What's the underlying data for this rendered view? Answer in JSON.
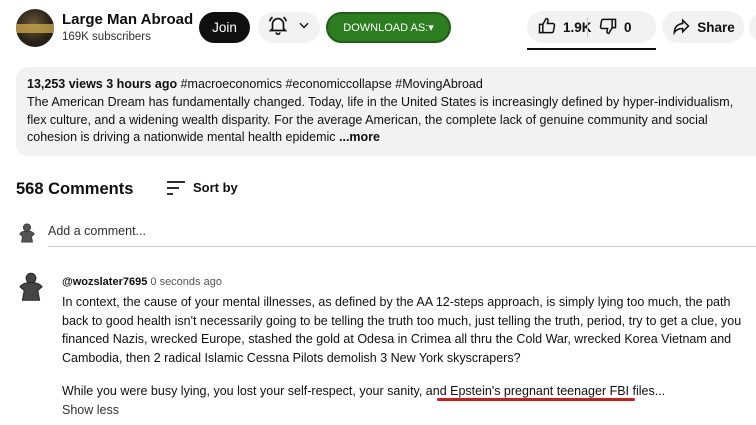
{
  "channel": {
    "name": "Large Man Abroad",
    "subscribers": "169K subscribers",
    "join_label": "Join",
    "download_label": "DOWNLOAD AS:▾"
  },
  "actions": {
    "likes": "1.9K",
    "dislikes": "0",
    "share_label": "Share"
  },
  "description": {
    "views": "13,253 views",
    "time": "3 hours ago",
    "tags": "#macroeconomics #economiccollapse #MovingAbroad",
    "text": "The American Dream has fundamentally changed. Today, life in the United States is increasingly defined by hyper-individualism, flex culture, and a widening wealth disparity. For the average American, the complete lack of genuine community and social cohesion is driving a nationwide mental health epidemic",
    "more_label": "...more"
  },
  "comments": {
    "count": "568 Comments",
    "sort_label": "Sort by",
    "add_placeholder": "Add a comment...",
    "items": [
      {
        "author": "@wozslater7695",
        "time": "0 seconds ago",
        "paragraph1": "In context, the cause of your mental illnesses, as defined by the AA 12-steps approach, is simply lying too much, the path back to good health isn't necessarily going to be telling the truth too much, just telling the truth, period, try to get a clue, you financed Nazis, wrecked Europe, stashed the gold at Odesa in Crimea all thru the Cold War, wrecked Korea Vietnam and Cambodia, then 2 radical Islamic Cessna Pilots demolish 3 New York skyscrapers?",
        "paragraph2": "While you were busy lying, you lost your self-respect, your sanity, and Epstein's pregnant teenager FBI files...",
        "show_less_label": "Show less"
      }
    ]
  },
  "colors": {
    "download_green": "#2b7d1f",
    "annotation_red": "#d21a1a",
    "chip_gray": "#f2f2f2"
  },
  "icons": [
    "bell-icon",
    "chevron-down-icon",
    "thumbs-up-icon",
    "thumbs-down-icon",
    "share-icon",
    "sort-icon",
    "user-avatar-icon"
  ]
}
